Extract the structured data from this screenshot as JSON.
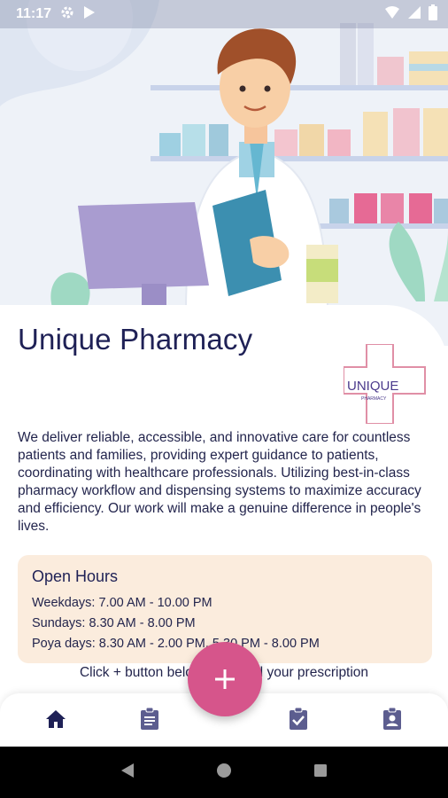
{
  "status_bar": {
    "time": "11:17"
  },
  "app": {
    "title": "Unique Pharmacy",
    "logo_text": "UNIQUE",
    "logo_subtext": "PHARMACY",
    "description": "We deliver reliable, accessible, and innovative care for countless patients and families, providing expert guidance to patients, coordinating with healthcare professionals. Utilizing best-in-class pharmacy workflow and dispensing systems to maximize accuracy and efficiency. Our work will make a genuine difference in people's lives."
  },
  "open_hours": {
    "title": "Open Hours",
    "lines": [
      "Weekdays: 7.00 AM - 10.00 PM",
      "Sundays: 8.30 AM - 8.00 PM",
      "Poya days: 8.30 AM - 2.00 PM, 5.30 PM - 8.00 PM"
    ]
  },
  "hint": "Click + button below to upload your prescription",
  "bottom_nav": {
    "items": [
      {
        "icon": "home-icon",
        "active": true
      },
      {
        "icon": "clipboard-icon",
        "active": false
      },
      {
        "icon": "clipboard-check-icon",
        "active": false
      },
      {
        "icon": "contact-card-icon",
        "active": false
      }
    ]
  },
  "fab": {
    "icon": "plus-icon"
  },
  "colors": {
    "primary_text": "#1f2156",
    "accent": "#d6558b",
    "hours_bg": "#fbecdd",
    "nav_icon": "#5c5d8f",
    "nav_active": "#1f2156"
  }
}
